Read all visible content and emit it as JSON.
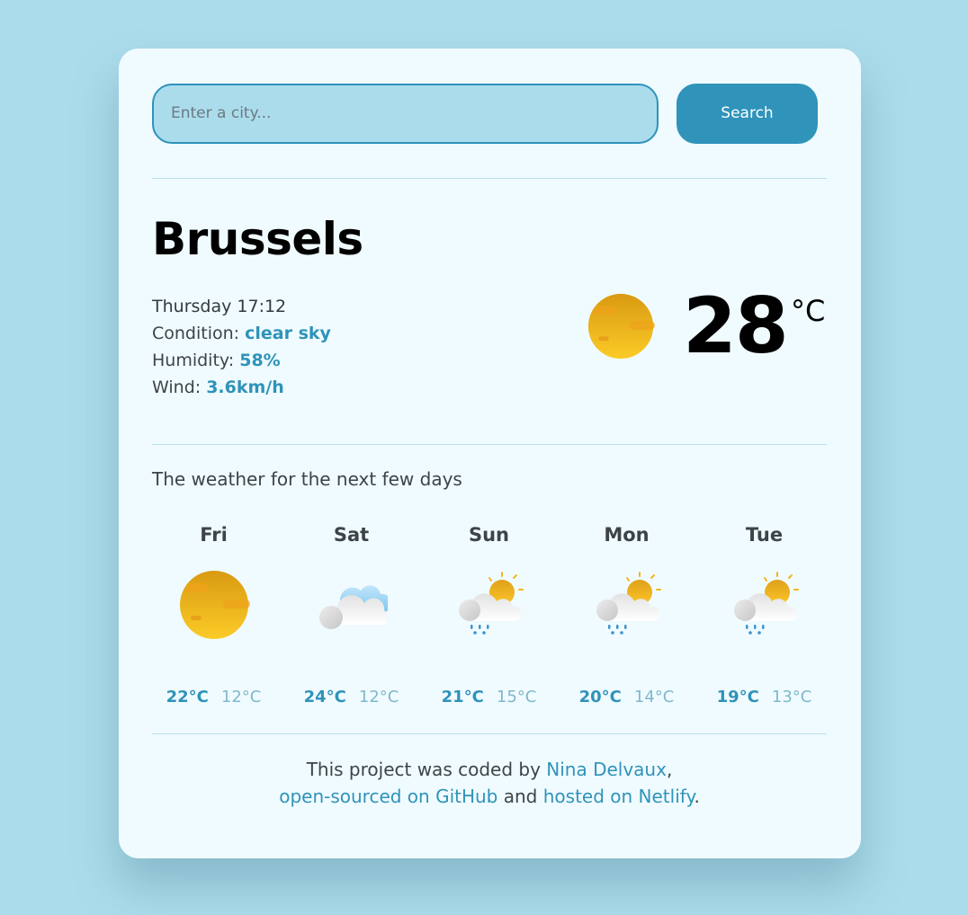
{
  "search": {
    "placeholder": "Enter a city...",
    "value": "",
    "button_label": "Search"
  },
  "current": {
    "city": "Brussels",
    "datetime": "Thursday 17:12",
    "condition_label": "Condition: ",
    "condition": "clear sky",
    "humidity_label": "Humidity: ",
    "humidity": "58%",
    "wind_label": "Wind: ",
    "wind": "3.6km/h",
    "icon": "clear-sky-icon",
    "temperature": "28",
    "unit": "°C"
  },
  "forecast": {
    "title": "The weather for the next few days",
    "days": [
      {
        "day": "Fri",
        "icon": "clear-sky-icon",
        "max": "22°C",
        "min": "12°C"
      },
      {
        "day": "Sat",
        "icon": "few-clouds-icon",
        "max": "24°C",
        "min": "12°C"
      },
      {
        "day": "Sun",
        "icon": "rain-sun-icon",
        "max": "21°C",
        "min": "15°C"
      },
      {
        "day": "Mon",
        "icon": "rain-sun-icon",
        "max": "20°C",
        "min": "14°C"
      },
      {
        "day": "Tue",
        "icon": "rain-sun-icon",
        "max": "19°C",
        "min": "13°C"
      }
    ]
  },
  "footer": {
    "text1": "This project was coded by ",
    "author_link": "Nina Delvaux",
    "comma": ",",
    "github_link": "open-sourced on GitHub",
    "and": " and ",
    "netlify_link": "hosted on Netlify",
    "period": "."
  },
  "colors": {
    "accent": "#2f93ba",
    "background": "#abdcec",
    "card": "#f0fbff"
  }
}
